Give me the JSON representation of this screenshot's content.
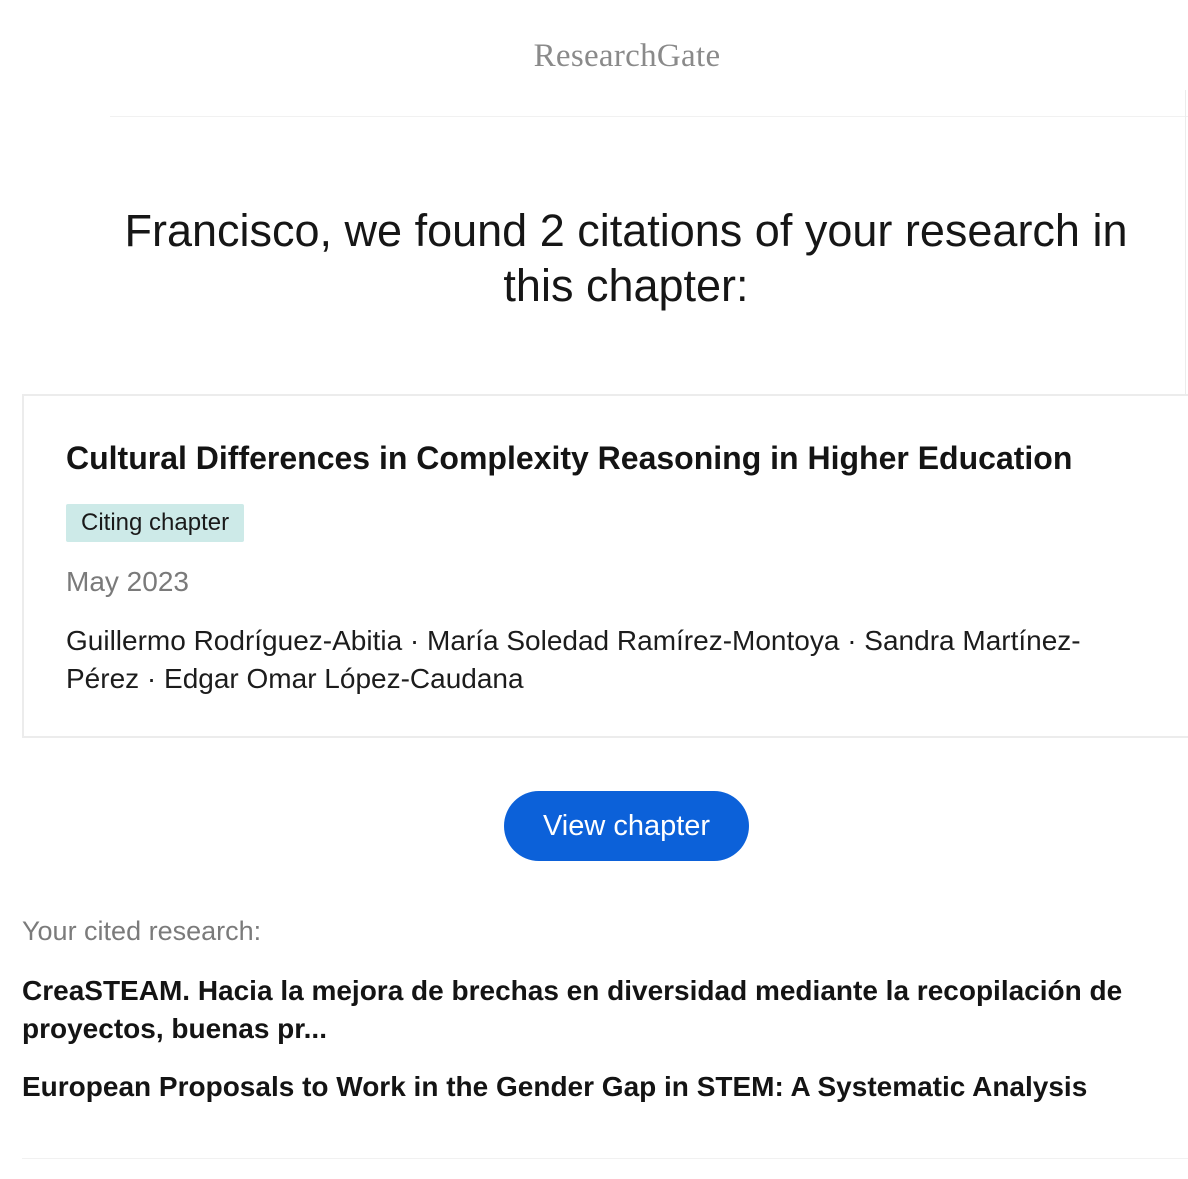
{
  "header": {
    "logo_text": "ResearchGate"
  },
  "headline": "Francisco, we found 2 citations of your research in this chapter:",
  "chapter_card": {
    "title": "Cultural Differences in Complexity Reasoning in Higher Education",
    "badge": "Citing chapter",
    "date": "May 2023",
    "authors": "Guillermo Rodríguez-Abitia · María Soledad Ramírez-Montoya · Sandra Martínez-Pérez · Edgar Omar López-Caudana"
  },
  "view_button": {
    "label": "View chapter",
    "color": "#0c61d9"
  },
  "cited_research": {
    "label": "Your cited research:",
    "items": [
      "CreaSTEAM. Hacia la mejora de brechas en diversidad mediante la recopilación de proyectos, buenas pr...",
      "European Proposals to Work in the Gender Gap in STEM: A Systematic Analysis"
    ]
  },
  "colors": {
    "badge_background": "#cdeae8",
    "muted_text": "#7a7a7a"
  }
}
